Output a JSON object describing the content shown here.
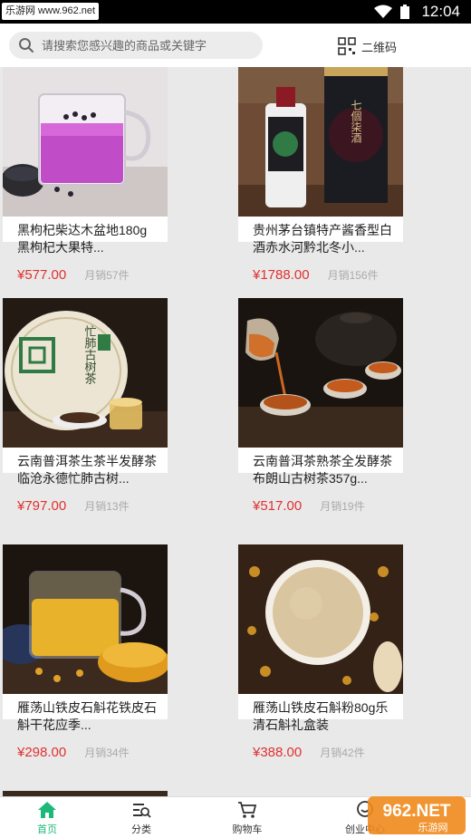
{
  "status_bar": {
    "watermark": "乐游网 www.962.net",
    "time": "12:04"
  },
  "search": {
    "placeholder": "请搜索您感兴趣的商品或关键字",
    "qr_label": "二维码"
  },
  "products": [
    {
      "title": "黑枸杞柴达木盆地180g黑枸杞大果特...",
      "price": "¥577.00",
      "sales": "月销57件"
    },
    {
      "title": "贵州茅台镇特产酱香型白酒赤水河黔北冬小...",
      "price": "¥1788.00",
      "sales": "月销156件"
    },
    {
      "title": "云南普洱茶生茶半发酵茶临沧永德忙肺古树...",
      "price": "¥797.00",
      "sales": "月销13件"
    },
    {
      "title": "云南普洱茶熟茶全发酵茶布朗山古树茶357g...",
      "price": "¥517.00",
      "sales": "月销19件"
    },
    {
      "title": "雁荡山铁皮石斛花铁皮石斛干花应季...",
      "price": "¥298.00",
      "sales": "月销34件"
    },
    {
      "title": "雁荡山铁皮石斛粉80g乐清石斛礼盒装",
      "price": "¥388.00",
      "sales": "月销42件"
    }
  ],
  "product_images": {
    "p2_box_text": "七個柒酒",
    "p3_cake_text": "忙肺古树茶"
  },
  "bottom_nav": [
    {
      "label": "首页",
      "icon": "home-icon"
    },
    {
      "label": "分类",
      "icon": "category-icon"
    },
    {
      "label": "购物车",
      "icon": "cart-icon"
    },
    {
      "label": "创业中心",
      "icon": "startup-center-icon"
    }
  ],
  "watermark_badge": {
    "brand": "962.NET",
    "sub": "乐游网"
  },
  "colors": {
    "accent": "#1db97a",
    "price": "#e0312f",
    "background": "#e9e9e9"
  }
}
